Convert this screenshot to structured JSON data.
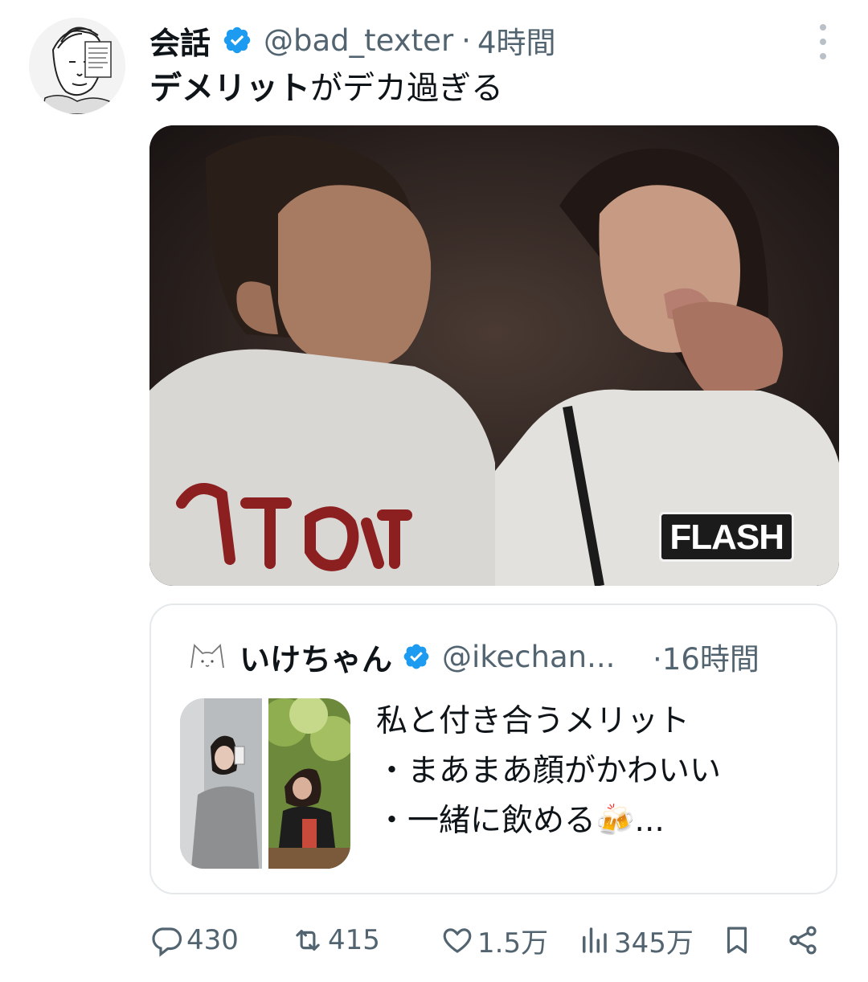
{
  "tweet": {
    "display_name": "会話",
    "handle": "@bad_texter",
    "separator": "·",
    "time": "4時間",
    "text_bold": "デメリット",
    "text_rest": "がデカ過ぎる",
    "media_logo": "FLASH"
  },
  "quoted": {
    "display_name": "いけちゃん",
    "handle": "@ikechan...",
    "time": "·16時間",
    "lines": [
      "私と付き合うメリット",
      "・まあまあ顔がかわいい",
      "・一緒に飲める🍻..."
    ]
  },
  "actions": {
    "replies": "430",
    "retweets": "415",
    "likes": "1.5万",
    "views": "345万"
  },
  "icons": {
    "verified": "verified-badge-icon",
    "reply": "reply-icon",
    "retweet": "retweet-icon",
    "like": "heart-icon",
    "views": "views-icon",
    "bookmark": "bookmark-icon",
    "share": "share-icon",
    "more": "more-icon"
  },
  "colors": {
    "verified": "#1d9bf0",
    "secondary_text": "#536471",
    "primary_text": "#0f1419"
  }
}
